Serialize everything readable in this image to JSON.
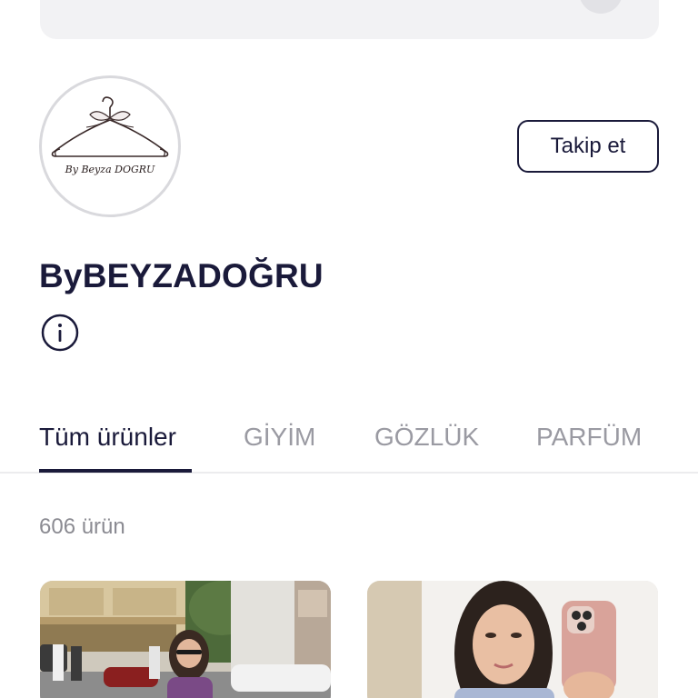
{
  "header": {
    "search_bar": {
      "icon": "camera-scan-icon"
    }
  },
  "store": {
    "logo_text": "By Beyza DOGRU",
    "name": "ByBEYZADOĞRU",
    "follow_label": "Takip et",
    "info_icon": "info-icon"
  },
  "tabs": [
    {
      "label": "Tüm ürünler",
      "active": true
    },
    {
      "label": "GİYİM",
      "active": false
    },
    {
      "label": "GÖZLÜK",
      "active": false
    },
    {
      "label": "PARFÜM",
      "active": false
    }
  ],
  "product_count": "606 ürün",
  "products": [
    {
      "image": "street-photo"
    },
    {
      "image": "mirror-selfie-photo"
    }
  ],
  "colors": {
    "text_primary": "#1a1a3a",
    "text_muted": "#9a9aa2",
    "surface": "#f2f2f4"
  }
}
